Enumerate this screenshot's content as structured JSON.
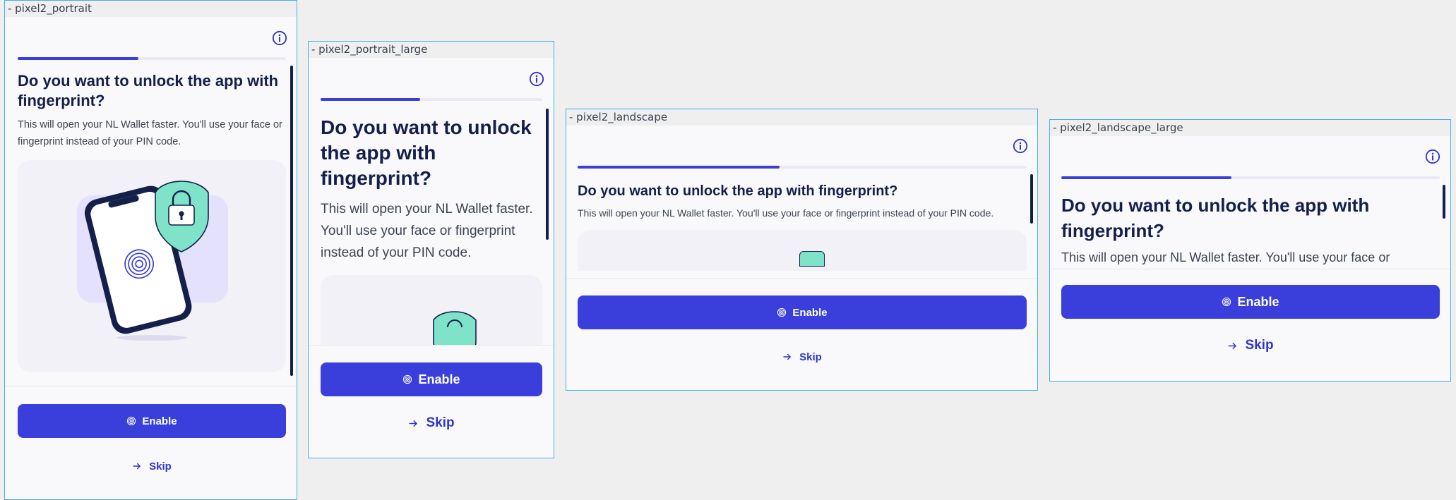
{
  "colors": {
    "primary": "#3a3fdb",
    "title": "#14204a",
    "body_text": "#3a4351",
    "progress_track": "#e9eaf3",
    "illustration_bg": "#f1f1f7",
    "frame_border": "#4aaee0"
  },
  "screen": {
    "title": "Do you want to unlock the app with fingerprint?",
    "description": "This will open your NL Wallet faster. You'll use your face or fingerprint instead of your PIN code.",
    "progress": 0.45,
    "info_icon": "info-circle-icon",
    "enable_label": "Enable",
    "enable_icon": "fingerprint-icon",
    "skip_label": "Skip",
    "skip_icon": "arrow-right-icon"
  },
  "frames": [
    {
      "label": "- pixel2_portrait"
    },
    {
      "label": "- pixel2_portrait_large"
    },
    {
      "label": "- pixel2_landscape"
    },
    {
      "label": "- pixel2_landscape_large"
    }
  ]
}
